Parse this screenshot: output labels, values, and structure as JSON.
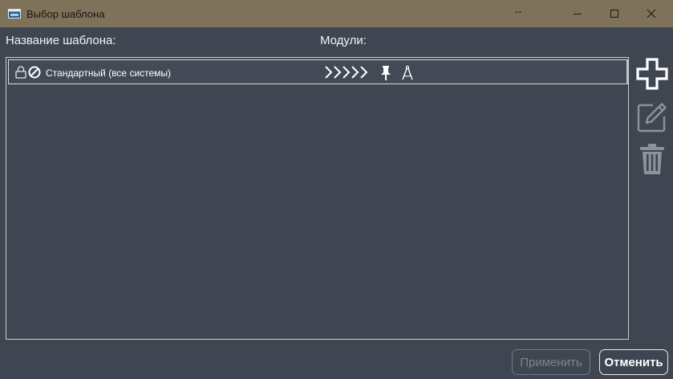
{
  "window": {
    "title": "Выбор шаблона",
    "resize_indicator": "↔",
    "minimize_label": "Minimize",
    "maximize_label": "Maximize",
    "close_label": "Close"
  },
  "columns": {
    "name_label": "Название шаблона:",
    "modules_label": "Модули:"
  },
  "templates": [
    {
      "name": "Стандартный (все системы)",
      "status_icons": [
        "lock-icon",
        "no-entry-icon"
      ],
      "module_icons": [
        "chevron-chain-icon",
        "pin-icon",
        "compass-icon"
      ]
    }
  ],
  "side_actions": [
    {
      "icon": "plus-icon",
      "enabled": true
    },
    {
      "icon": "pencil-icon",
      "enabled": false
    },
    {
      "icon": "trash-icon",
      "enabled": false
    }
  ],
  "buttons": {
    "apply_label": "Применить",
    "cancel_label": "Отменить"
  },
  "colors": {
    "titlebar": "#7e735a",
    "background": "#3f4651",
    "text": "#f2f2f2"
  }
}
